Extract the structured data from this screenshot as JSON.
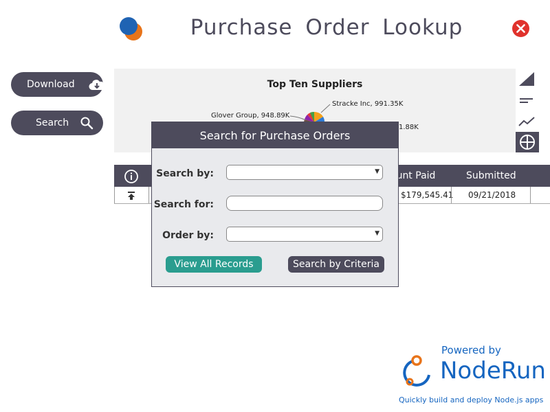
{
  "header": {
    "title": "Purchase Order Lookup"
  },
  "sidebar": {
    "download_label": "Download",
    "search_label": "Search"
  },
  "chart_data": {
    "type": "pie",
    "title": "Top Ten Suppliers",
    "categories": [
      "Glover Group",
      "Stracke Inc"
    ],
    "values": [
      948.89,
      991.35
    ],
    "labels": [
      "Glover Group, 948.89K",
      "Stracke Inc, 991.35K",
      "1.88K"
    ]
  },
  "grid": {
    "headers": [
      "ount Paid",
      "Submitted"
    ],
    "row": {
      "amount_paid": "$179,545.41",
      "submitted": "09/21/2018"
    }
  },
  "dialog": {
    "title": "Search for Purchase Orders",
    "search_by_label": "Search by:",
    "search_for_label": "Search for:",
    "order_by_label": "Order by:",
    "search_by_value": "",
    "search_for_value": "",
    "order_by_value": "",
    "view_all_label": "View All Records",
    "search_criteria_label": "Search by Criteria"
  },
  "powered": {
    "top": "Powered by",
    "name": "NodeRun",
    "tagline": "Quickly build and deploy Node.js apps"
  },
  "colors": {
    "primary_dark": "#4d4b5c",
    "accent_teal": "#2a9d8f",
    "close_red": "#e0322c",
    "brand_blue": "#1565c0"
  }
}
